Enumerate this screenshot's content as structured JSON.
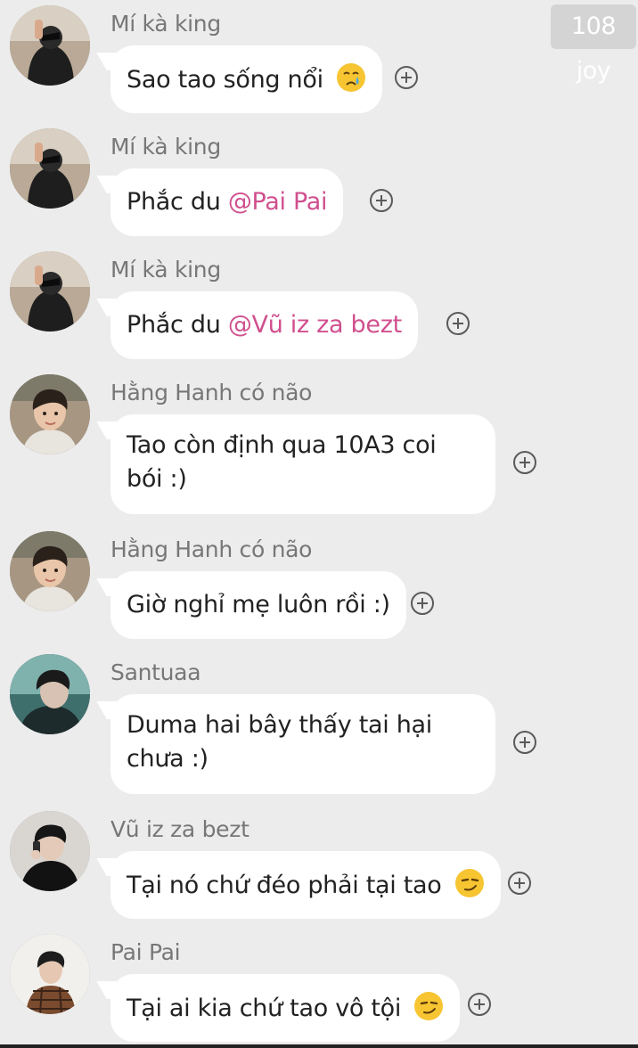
{
  "watermark": "108 joy",
  "colors": {
    "background": "#ececec",
    "bubble": "#ffffff",
    "mention": "#d0508e",
    "sender_name": "#777777"
  },
  "messages": [
    {
      "sender": "Mí kà king",
      "avatar_icon": "avatar-hooded-person",
      "text": "Sao tao sống nổi",
      "mention": "",
      "emoji": "crying-face-emoji"
    },
    {
      "sender": "Mí kà king",
      "avatar_icon": "avatar-hooded-person",
      "text": "Phắc du",
      "mention": "@Pai Pai",
      "emoji": ""
    },
    {
      "sender": "Mí kà king",
      "avatar_icon": "avatar-hooded-person",
      "text": "Phắc du",
      "mention": "@Vũ iz za bezt",
      "emoji": ""
    },
    {
      "sender": "Hằng Hanh có não",
      "avatar_icon": "avatar-boy-portrait",
      "text": "Tao còn định qua 10A3 coi bói :)",
      "mention": "",
      "emoji": ""
    },
    {
      "sender": "Hằng Hanh có não",
      "avatar_icon": "avatar-boy-portrait",
      "text": "Giờ nghỉ mẹ luôn rồi :)",
      "mention": "",
      "emoji": ""
    },
    {
      "sender": "Santuaa",
      "avatar_icon": "avatar-teal-portrait",
      "text": "Duma hai bây thấy tai hại chưa :)",
      "mention": "",
      "emoji": ""
    },
    {
      "sender": "Vũ iz za bezt",
      "avatar_icon": "avatar-phone-portrait",
      "text": "Tại nó chứ đéo phải tại tao",
      "mention": "",
      "emoji": "smirking-face-emoji"
    },
    {
      "sender": "Pai Pai",
      "avatar_icon": "avatar-plaid-jacket",
      "text": "Tại ai kia chứ tao vô tội",
      "mention": "",
      "emoji": "smirking-face-emoji"
    }
  ]
}
